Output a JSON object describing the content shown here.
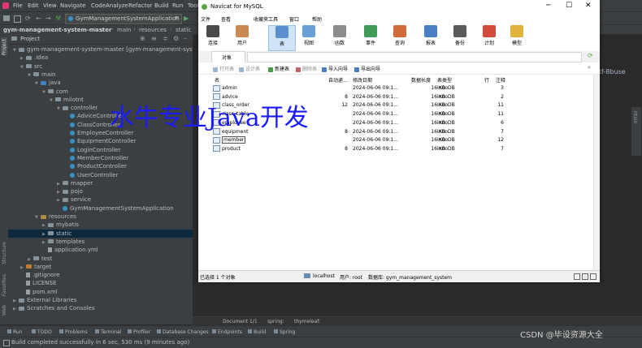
{
  "ide": {
    "menu": [
      "File",
      "Edit",
      "View",
      "Navigate",
      "Code",
      "Analyze",
      "Refactor",
      "Build",
      "Run",
      "Tools"
    ],
    "run_config": "GymManagementSystemApplication",
    "breadcrumb": [
      "gym-management-system-master",
      "src",
      "main",
      "resources",
      "static"
    ],
    "project_label": "Project",
    "side_tabs": [
      "Project",
      "Structure",
      "Favorites",
      "Web"
    ],
    "tree": [
      {
        "label": "gym-management-system-master [gym-management-system]",
        "indent": 0,
        "icon": "folder",
        "arrow": "down"
      },
      {
        "label": ".idea",
        "indent": 1,
        "icon": "folder",
        "arrow": "right"
      },
      {
        "label": "src",
        "indent": 1,
        "icon": "folder",
        "arrow": "down"
      },
      {
        "label": "main",
        "indent": 2,
        "icon": "folder",
        "arrow": "down"
      },
      {
        "label": "java",
        "indent": 3,
        "icon": "src",
        "arrow": "down"
      },
      {
        "label": "com",
        "indent": 4,
        "icon": "folder",
        "arrow": "down"
      },
      {
        "label": "milotnt",
        "indent": 5,
        "icon": "folder",
        "arrow": "down"
      },
      {
        "label": "controller",
        "indent": 6,
        "icon": "folder",
        "arrow": "down"
      },
      {
        "label": "AdviceController",
        "indent": 7,
        "icon": "class",
        "arrow": ""
      },
      {
        "label": "ClassController",
        "indent": 7,
        "icon": "class",
        "arrow": ""
      },
      {
        "label": "EmployeeController",
        "indent": 7,
        "icon": "class",
        "arrow": ""
      },
      {
        "label": "EquipmentController",
        "indent": 7,
        "icon": "class",
        "arrow": ""
      },
      {
        "label": "LoginController",
        "indent": 7,
        "icon": "class",
        "arrow": ""
      },
      {
        "label": "MemberController",
        "indent": 7,
        "icon": "class",
        "arrow": ""
      },
      {
        "label": "ProductController",
        "indent": 7,
        "icon": "class",
        "arrow": ""
      },
      {
        "label": "UserController",
        "indent": 7,
        "icon": "class",
        "arrow": ""
      },
      {
        "label": "mapper",
        "indent": 6,
        "icon": "folder",
        "arrow": "right"
      },
      {
        "label": "pojo",
        "indent": 6,
        "icon": "folder",
        "arrow": "right"
      },
      {
        "label": "service",
        "indent": 6,
        "icon": "folder",
        "arrow": "right"
      },
      {
        "label": "GymManagementSystemApplication",
        "indent": 6,
        "icon": "class",
        "arrow": ""
      },
      {
        "label": "resources",
        "indent": 3,
        "icon": "res",
        "arrow": "down"
      },
      {
        "label": "mybatis",
        "indent": 4,
        "icon": "folder",
        "arrow": "right"
      },
      {
        "label": "static",
        "indent": 4,
        "icon": "folder",
        "arrow": "right",
        "selected": true
      },
      {
        "label": "templates",
        "indent": 4,
        "icon": "folder",
        "arrow": "right"
      },
      {
        "label": "application.yml",
        "indent": 4,
        "icon": "file",
        "arrow": ""
      },
      {
        "label": "test",
        "indent": 2,
        "icon": "folder",
        "arrow": "right"
      },
      {
        "label": "target",
        "indent": 1,
        "icon": "orange",
        "arrow": "right"
      },
      {
        "label": ".gitignore",
        "indent": 1,
        "icon": "file",
        "arrow": ""
      },
      {
        "label": "LICENSE",
        "indent": 1,
        "icon": "file",
        "arrow": ""
      },
      {
        "label": "pom.xml",
        "indent": 1,
        "icon": "file",
        "arrow": ""
      },
      {
        "label": "External Libraries",
        "indent": 0,
        "icon": "folder",
        "arrow": "right"
      },
      {
        "label": "Scratches and Consoles",
        "indent": 0,
        "icon": "folder",
        "arrow": "right"
      }
    ],
    "editor_fragments": {
      "right_text1": "tf-8buse",
      "right_text2": "ntain",
      "tab_a": "Document 1/1",
      "tab_b": "spring:",
      "tab_c": "thymeleaf:"
    },
    "bottom_tabs": [
      "Run",
      "TODO",
      "Problems",
      "Terminal",
      "Profiler",
      "Database Changes",
      "Endpoints",
      "Build",
      "Spring"
    ],
    "status": "Build completed successfully in 6 sec, 530 ms (9 minutes ago)"
  },
  "navicat": {
    "title": "Navicat for MySQL",
    "menu": [
      "文件",
      "查看",
      "收藏夹",
      "工具",
      "窗口",
      "帮助"
    ],
    "toolbar": [
      {
        "label": "连接",
        "color": "#4a4a4a"
      },
      {
        "label": "用户",
        "color": "#c98a52"
      },
      {
        "label": "表",
        "color": "#5a8fd0",
        "active": true
      },
      {
        "label": "视图",
        "color": "#6aa0d8"
      },
      {
        "label": "函数",
        "color": "#8c8c8c"
      },
      {
        "label": "事件",
        "color": "#3f9a55"
      },
      {
        "label": "查询",
        "color": "#d06b3a"
      },
      {
        "label": "报表",
        "color": "#4b7fc4"
      },
      {
        "label": "备份",
        "color": "#5a5a5a"
      },
      {
        "label": "计划",
        "color": "#d24a3a"
      },
      {
        "label": "模型",
        "color": "#e0b23a"
      }
    ],
    "object_tab": "对象",
    "actions": [
      {
        "label": "打开表",
        "dim": true
      },
      {
        "label": "设计表",
        "dim": true
      },
      {
        "label": "新建表",
        "dim": false
      },
      {
        "label": "删除表",
        "dim": true
      },
      {
        "label": "导入向导",
        "dim": false
      },
      {
        "label": "导出向导",
        "dim": false
      }
    ],
    "columns": [
      "名",
      "自动递...",
      "修改日期",
      "数据长度",
      "表类型",
      "行",
      "注释"
    ],
    "rows": [
      {
        "name": "admin",
        "auto": "",
        "date": "2024-06-06 09:1...",
        "size": "16 KB",
        "engine": "InnoDB",
        "rows": "3"
      },
      {
        "name": "advice",
        "auto": "8",
        "date": "2024-06-06 09:1...",
        "size": "16 KB",
        "engine": "InnoDB",
        "rows": "2"
      },
      {
        "name": "class_order",
        "auto": "12",
        "date": "2024-06-06 09:1...",
        "size": "16 KB",
        "engine": "InnoDB",
        "rows": "11"
      },
      {
        "name": "class_table",
        "auto": "",
        "date": "2024-06-06 09:1...",
        "size": "16 KB",
        "engine": "InnoDB",
        "rows": "11"
      },
      {
        "name": "employee",
        "auto": "",
        "date": "2024-06-06 09:1...",
        "size": "16 KB",
        "engine": "InnoDB",
        "rows": "6"
      },
      {
        "name": "equipment",
        "auto": "8",
        "date": "2024-06-06 09:1...",
        "size": "16 KB",
        "engine": "InnoDB",
        "rows": "7"
      },
      {
        "name": "member",
        "auto": "",
        "date": "2024-06-06 09:1...",
        "size": "16 KB",
        "engine": "InnoDB",
        "rows": "12"
      },
      {
        "name": "product",
        "auto": "8",
        "date": "2024-06-06 09:1...",
        "size": "16 KB",
        "engine": "InnoDB",
        "rows": "7"
      }
    ],
    "status": {
      "selected": "已选择 1 个对象",
      "host": "localhost",
      "user": "用户: root",
      "db": "数据库: gym_management_system"
    }
  },
  "overlay": {
    "watermark": "水牛专业Java开发",
    "csdn": "CSDN @毕设资源大全"
  }
}
